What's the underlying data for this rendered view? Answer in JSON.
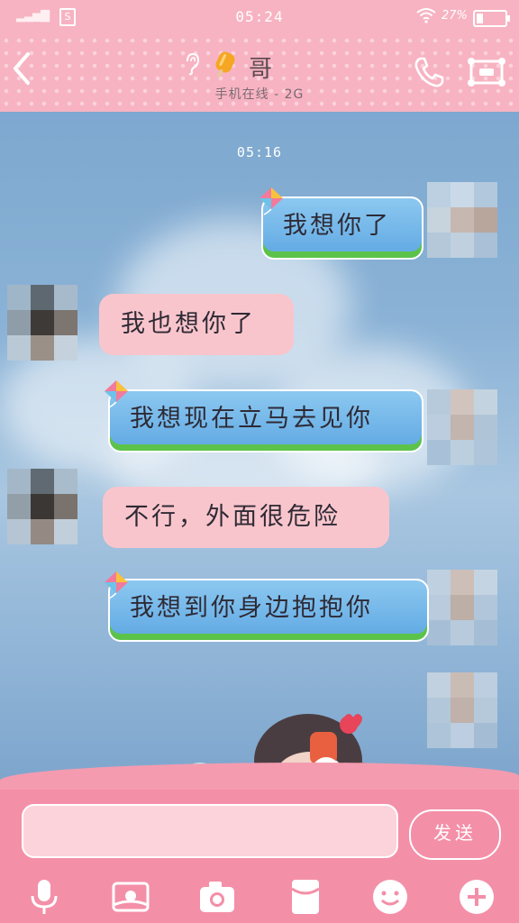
{
  "status_bar": {
    "sim_label": "S",
    "time": "05:24",
    "battery_pct": "27%"
  },
  "header": {
    "contact_name": "哥",
    "contact_status": "手机在线 - 2G"
  },
  "chat": {
    "timestamp": "05:16",
    "messages": [
      {
        "direction": "out",
        "text": "我想你了"
      },
      {
        "direction": "in",
        "text": "我也想你了"
      },
      {
        "direction": "out",
        "text": "我想现在立马去见你"
      },
      {
        "direction": "in",
        "text": "不行，外面很危险"
      },
      {
        "direction": "out",
        "text": "我想到你身边抱抱你"
      }
    ]
  },
  "composer": {
    "input_value": "",
    "send_label": "发送"
  },
  "toolbar": {
    "icons": [
      "microphone-icon",
      "photo-icon",
      "camera-icon",
      "red-packet-icon",
      "emoji-icon",
      "plus-icon"
    ]
  },
  "colors": {
    "theme_pink": "#f7b3c2",
    "bar_pink": "#f48fa8",
    "out_bubble": "#5fa8e3",
    "in_bubble": "#f9c5cc",
    "grass_green": "#5cc34a"
  }
}
